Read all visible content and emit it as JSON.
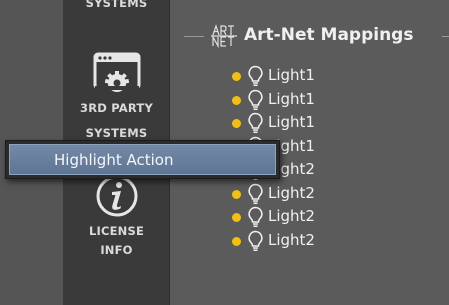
{
  "nav": {
    "items": [
      {
        "label": "SYSTEMS",
        "icon": "systems-icon"
      },
      {
        "label_line1": "3RD PARTY",
        "label_line2": "SYSTEMS",
        "icon": "third-party-window-gear-icon"
      },
      {
        "label_line1": "LICENSE",
        "label_line2": "INFO",
        "icon": "info-icon"
      }
    ]
  },
  "section": {
    "title": "Art-Net Mappings",
    "icon": "artnet-icon"
  },
  "mappings": [
    {
      "label": "Light1",
      "status_color": "#f2c012",
      "icon": "lightbulb-icon"
    },
    {
      "label": "Light1",
      "status_color": "#f2c012",
      "icon": "lightbulb-icon"
    },
    {
      "label": "Light1",
      "status_color": "#f2c012",
      "icon": "lightbulb-icon"
    },
    {
      "label": "Light1",
      "status_color": "#f2c012",
      "icon": "lightbulb-icon"
    },
    {
      "label": "Light2",
      "status_color": "#f2c012",
      "icon": "lightbulb-icon"
    },
    {
      "label": "Light2",
      "status_color": "#f2c012",
      "icon": "lightbulb-icon"
    },
    {
      "label": "Light2",
      "status_color": "#f2c012",
      "icon": "lightbulb-icon"
    },
    {
      "label": "Light2",
      "status_color": "#f2c012",
      "icon": "lightbulb-icon"
    }
  ],
  "context_menu": {
    "items": [
      {
        "label": "Highlight Action",
        "highlighted": true
      }
    ]
  },
  "colors": {
    "accent_highlight": "#6a81a0",
    "status_dot": "#f2c012",
    "nav_panel": "#3a3a3a",
    "background": "#5b5b5b"
  }
}
